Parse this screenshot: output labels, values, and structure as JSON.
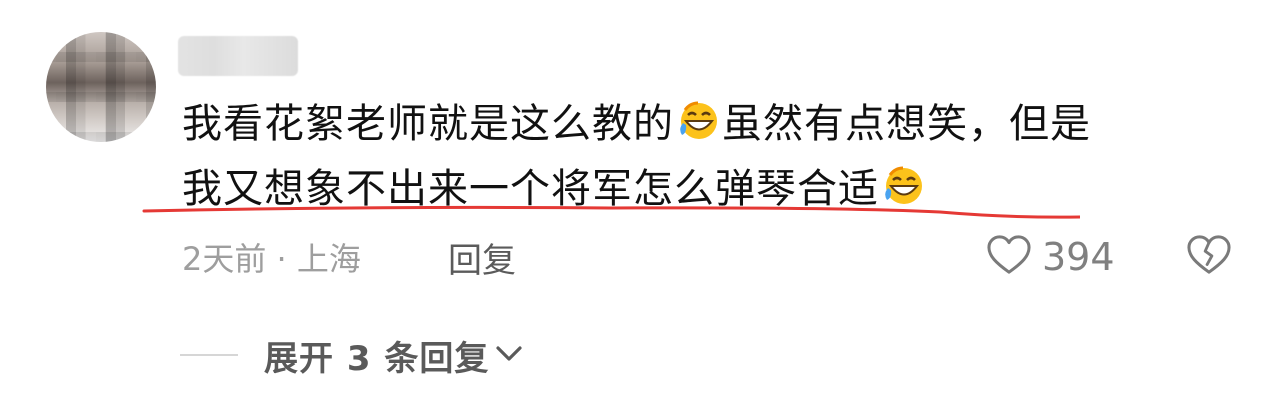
{
  "comment": {
    "line1_a": "我看花絮老师就是这么教的",
    "line1_b": "虽然有点想笑，但是",
    "line2_a": "我又想象不出来一个将军怎么弹琴合适"
  },
  "meta": {
    "time_location": "2天前 · 上海",
    "reply_label": "回复"
  },
  "actions": {
    "like_count": "394"
  },
  "replies": {
    "expand_label": "展开 3 条回复"
  },
  "colors": {
    "annotation_red": "#e53935",
    "emoji_yellow": "#fcc21b"
  },
  "icons": {
    "emoji": "laughing-tears-emoji-icon",
    "like": "heart-icon",
    "dislike": "broken-heart-icon",
    "expand": "chevron-down-icon"
  }
}
